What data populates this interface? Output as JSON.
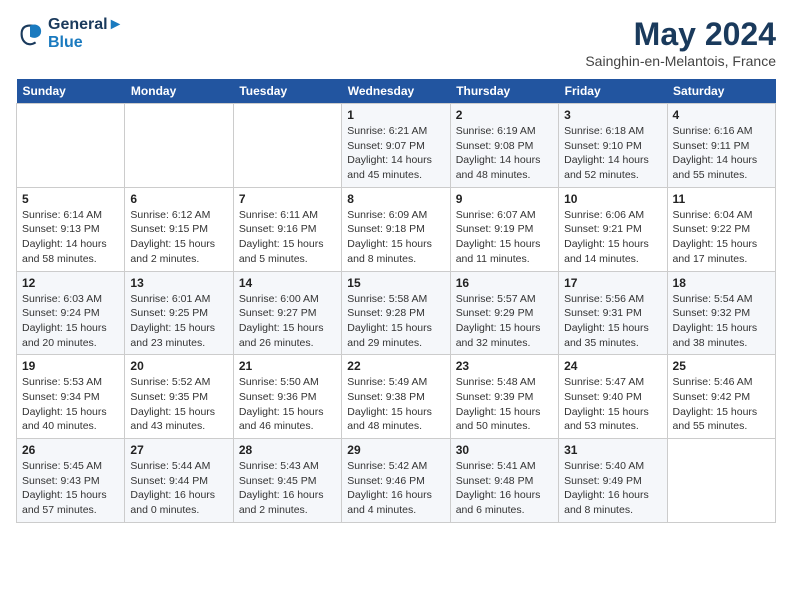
{
  "logo": {
    "line1": "General",
    "line2": "Blue"
  },
  "title": "May 2024",
  "subtitle": "Sainghin-en-Melantois, France",
  "headers": [
    "Sunday",
    "Monday",
    "Tuesday",
    "Wednesday",
    "Thursday",
    "Friday",
    "Saturday"
  ],
  "weeks": [
    [
      {
        "day": "",
        "info": ""
      },
      {
        "day": "",
        "info": ""
      },
      {
        "day": "",
        "info": ""
      },
      {
        "day": "1",
        "info": "Sunrise: 6:21 AM\nSunset: 9:07 PM\nDaylight: 14 hours\nand 45 minutes."
      },
      {
        "day": "2",
        "info": "Sunrise: 6:19 AM\nSunset: 9:08 PM\nDaylight: 14 hours\nand 48 minutes."
      },
      {
        "day": "3",
        "info": "Sunrise: 6:18 AM\nSunset: 9:10 PM\nDaylight: 14 hours\nand 52 minutes."
      },
      {
        "day": "4",
        "info": "Sunrise: 6:16 AM\nSunset: 9:11 PM\nDaylight: 14 hours\nand 55 minutes."
      }
    ],
    [
      {
        "day": "5",
        "info": "Sunrise: 6:14 AM\nSunset: 9:13 PM\nDaylight: 14 hours\nand 58 minutes."
      },
      {
        "day": "6",
        "info": "Sunrise: 6:12 AM\nSunset: 9:15 PM\nDaylight: 15 hours\nand 2 minutes."
      },
      {
        "day": "7",
        "info": "Sunrise: 6:11 AM\nSunset: 9:16 PM\nDaylight: 15 hours\nand 5 minutes."
      },
      {
        "day": "8",
        "info": "Sunrise: 6:09 AM\nSunset: 9:18 PM\nDaylight: 15 hours\nand 8 minutes."
      },
      {
        "day": "9",
        "info": "Sunrise: 6:07 AM\nSunset: 9:19 PM\nDaylight: 15 hours\nand 11 minutes."
      },
      {
        "day": "10",
        "info": "Sunrise: 6:06 AM\nSunset: 9:21 PM\nDaylight: 15 hours\nand 14 minutes."
      },
      {
        "day": "11",
        "info": "Sunrise: 6:04 AM\nSunset: 9:22 PM\nDaylight: 15 hours\nand 17 minutes."
      }
    ],
    [
      {
        "day": "12",
        "info": "Sunrise: 6:03 AM\nSunset: 9:24 PM\nDaylight: 15 hours\nand 20 minutes."
      },
      {
        "day": "13",
        "info": "Sunrise: 6:01 AM\nSunset: 9:25 PM\nDaylight: 15 hours\nand 23 minutes."
      },
      {
        "day": "14",
        "info": "Sunrise: 6:00 AM\nSunset: 9:27 PM\nDaylight: 15 hours\nand 26 minutes."
      },
      {
        "day": "15",
        "info": "Sunrise: 5:58 AM\nSunset: 9:28 PM\nDaylight: 15 hours\nand 29 minutes."
      },
      {
        "day": "16",
        "info": "Sunrise: 5:57 AM\nSunset: 9:29 PM\nDaylight: 15 hours\nand 32 minutes."
      },
      {
        "day": "17",
        "info": "Sunrise: 5:56 AM\nSunset: 9:31 PM\nDaylight: 15 hours\nand 35 minutes."
      },
      {
        "day": "18",
        "info": "Sunrise: 5:54 AM\nSunset: 9:32 PM\nDaylight: 15 hours\nand 38 minutes."
      }
    ],
    [
      {
        "day": "19",
        "info": "Sunrise: 5:53 AM\nSunset: 9:34 PM\nDaylight: 15 hours\nand 40 minutes."
      },
      {
        "day": "20",
        "info": "Sunrise: 5:52 AM\nSunset: 9:35 PM\nDaylight: 15 hours\nand 43 minutes."
      },
      {
        "day": "21",
        "info": "Sunrise: 5:50 AM\nSunset: 9:36 PM\nDaylight: 15 hours\nand 46 minutes."
      },
      {
        "day": "22",
        "info": "Sunrise: 5:49 AM\nSunset: 9:38 PM\nDaylight: 15 hours\nand 48 minutes."
      },
      {
        "day": "23",
        "info": "Sunrise: 5:48 AM\nSunset: 9:39 PM\nDaylight: 15 hours\nand 50 minutes."
      },
      {
        "day": "24",
        "info": "Sunrise: 5:47 AM\nSunset: 9:40 PM\nDaylight: 15 hours\nand 53 minutes."
      },
      {
        "day": "25",
        "info": "Sunrise: 5:46 AM\nSunset: 9:42 PM\nDaylight: 15 hours\nand 55 minutes."
      }
    ],
    [
      {
        "day": "26",
        "info": "Sunrise: 5:45 AM\nSunset: 9:43 PM\nDaylight: 15 hours\nand 57 minutes."
      },
      {
        "day": "27",
        "info": "Sunrise: 5:44 AM\nSunset: 9:44 PM\nDaylight: 16 hours\nand 0 minutes."
      },
      {
        "day": "28",
        "info": "Sunrise: 5:43 AM\nSunset: 9:45 PM\nDaylight: 16 hours\nand 2 minutes."
      },
      {
        "day": "29",
        "info": "Sunrise: 5:42 AM\nSunset: 9:46 PM\nDaylight: 16 hours\nand 4 minutes."
      },
      {
        "day": "30",
        "info": "Sunrise: 5:41 AM\nSunset: 9:48 PM\nDaylight: 16 hours\nand 6 minutes."
      },
      {
        "day": "31",
        "info": "Sunrise: 5:40 AM\nSunset: 9:49 PM\nDaylight: 16 hours\nand 8 minutes."
      },
      {
        "day": "",
        "info": ""
      }
    ]
  ]
}
